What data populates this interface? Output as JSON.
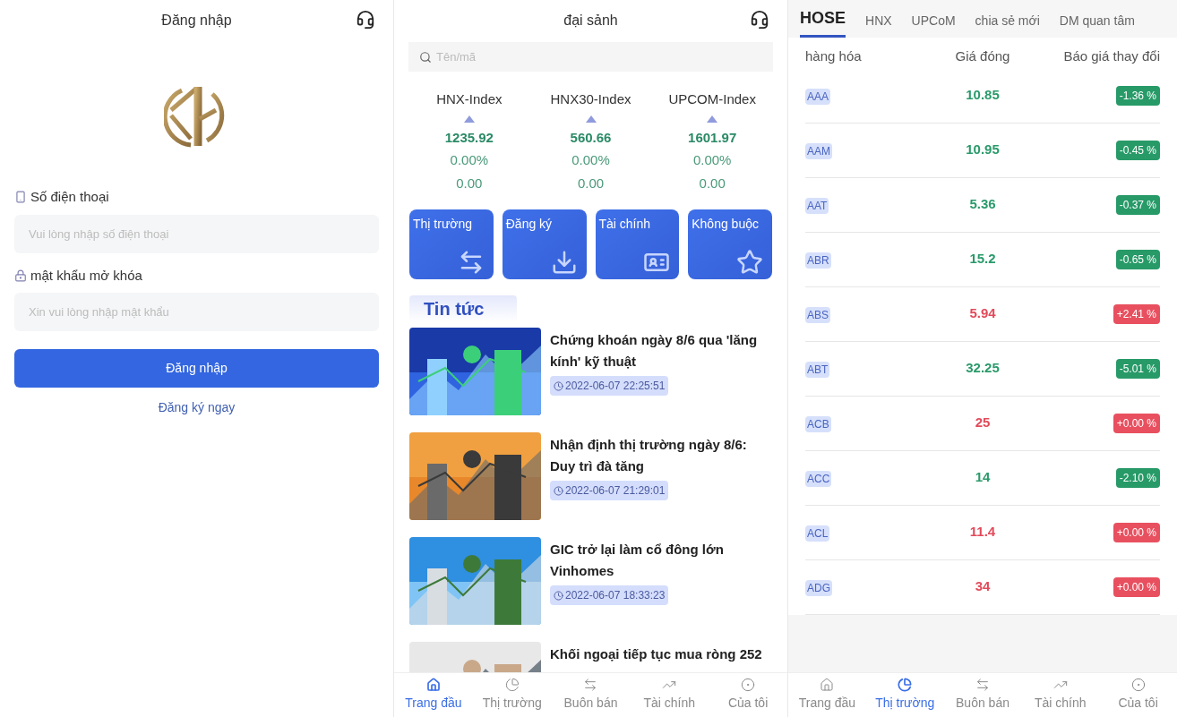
{
  "login": {
    "title": "Đăng nhập",
    "phone_label": "Số điện thoại",
    "phone_placeholder": "Vui lòng nhập số điện thoại",
    "password_label": "mật khẩu mở khóa",
    "password_placeholder": "Xin vui lòng nhập mật khẩu",
    "submit": "Đăng nhập",
    "register_link": "Đăng ký ngay"
  },
  "lobby": {
    "title": "đại sảnh",
    "search_placeholder": "Tên/mã",
    "indexes": [
      {
        "name": "HNX-Index",
        "kind": "up",
        "value": "1235.92",
        "percent": "0.00%",
        "change": "0.00"
      },
      {
        "name": "HNX30-Index",
        "kind": "up",
        "value": "560.66",
        "percent": "0.00%",
        "change": "0.00"
      },
      {
        "name": "UPCOM-Index",
        "kind": "up",
        "value": "1601.97",
        "percent": "0.00%",
        "change": "0.00"
      }
    ],
    "shortcuts": [
      "Thị trường",
      "Đăng ký",
      "Tài chính",
      "Không buộc"
    ],
    "news_heading": "Tin tức",
    "news": [
      {
        "title": "Chứng khoán ngày 8/6 qua 'lăng kính' kỹ thuật",
        "time": "2022-06-07 22:25:51"
      },
      {
        "title": "Nhận định thị trường ngày 8/6: Duy trì đà tăng",
        "time": "2022-06-07 21:29:01"
      },
      {
        "title": "GIC trở lại làm cổ đông lớn Vinhomes",
        "time": "2022-06-07 18:33:23"
      },
      {
        "title": "Khối ngoại tiếp tục mua ròng 252"
      }
    ],
    "nav": [
      {
        "label": "Trang đầu",
        "selected": true
      },
      {
        "label": "Thị trường",
        "selected": false
      },
      {
        "label": "Buôn bán",
        "selected": false
      },
      {
        "label": "Tài chính",
        "selected": false
      },
      {
        "label": "Của tôi",
        "selected": false
      }
    ]
  },
  "market": {
    "tabs": [
      {
        "label": "HOSE",
        "selected": true
      },
      {
        "label": "HNX",
        "selected": false
      },
      {
        "label": "UPCoM",
        "selected": false
      },
      {
        "label": "chia sẻ mới",
        "selected": false
      },
      {
        "label": "DM quan tâm",
        "selected": false
      }
    ],
    "columns": [
      "hàng hóa",
      "Giá đóng",
      "Báo giá thay đổi"
    ],
    "rows": [
      {
        "symbol": "AAA",
        "price": "10.85",
        "change": "-1.36 %",
        "kind": "down"
      },
      {
        "symbol": "AAM",
        "price": "10.95",
        "change": "-0.45 %",
        "kind": "down"
      },
      {
        "symbol": "AAT",
        "price": "5.36",
        "change": "-0.37 %",
        "kind": "down"
      },
      {
        "symbol": "ABR",
        "price": "15.2",
        "change": "-0.65 %",
        "kind": "down"
      },
      {
        "symbol": "ABS",
        "price": "5.94",
        "change": "+2.41 %",
        "kind": "up"
      },
      {
        "symbol": "ABT",
        "price": "32.25",
        "change": "-5.01 %",
        "kind": "down"
      },
      {
        "symbol": "ACB",
        "price": "25",
        "change": "+0.00 %",
        "kind": "up"
      },
      {
        "symbol": "ACC",
        "price": "14",
        "change": "-2.10 %",
        "kind": "down"
      },
      {
        "symbol": "ACL",
        "price": "11.4",
        "change": "+0.00 %",
        "kind": "up"
      },
      {
        "symbol": "ADG",
        "price": "34",
        "change": "+0.00 %",
        "kind": "up"
      }
    ],
    "nav": [
      {
        "label": "Trang đầu",
        "selected": false
      },
      {
        "label": "Thị trường",
        "selected": true
      },
      {
        "label": "Buôn bán",
        "selected": false
      },
      {
        "label": "Tài chính",
        "selected": false
      },
      {
        "label": "Của tôi",
        "selected": false
      }
    ]
  }
}
